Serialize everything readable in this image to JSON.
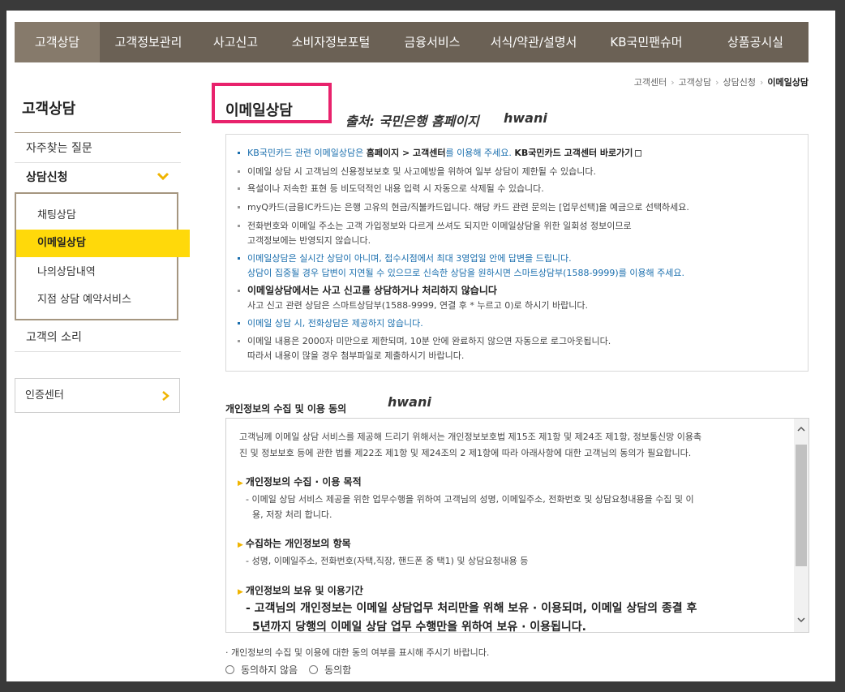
{
  "gnb": [
    "고객상담",
    "고객정보관리",
    "사고신고",
    "소비자정보포털",
    "금융서비스",
    "서식/약관/설명서",
    "KB국민팬슈머",
    "상품공시실"
  ],
  "lnb": {
    "title": "고객상담",
    "faq": "자주찾는 질문",
    "apply": "상담신청",
    "sub": [
      "채팅상담",
      "이메일상담",
      "나의상담내역",
      "지점 상담 예약서비스"
    ],
    "voice": "고객의 소리",
    "cert": "인증센터"
  },
  "breadcrumb": [
    "고객센터",
    "고객상담",
    "상담신청",
    "이메일상담"
  ],
  "page_title": "이메일상담",
  "source_note": "출처: 국민은행 홈페이지",
  "watermark": "hwani",
  "notice": {
    "l1a": "KB국민카드 관련 이메일상담은 ",
    "l1b": "홈페이지 > 고객센터",
    "l1c": "를 이용해 주세요. ",
    "l1d": "KB국민카드 고객센터 바로가기",
    "l2": "이메일 상담 시 고객님의 신용정보보호 및 사고예방을 위하여 일부 상담이 제한될 수 있습니다.",
    "l3": "욕설이나 저속한 표현 등 비도덕적인 내용 입력 시 자동으로 삭제될 수 있습니다.",
    "l4": "myQ카드(금융IC카드)는 은행 고유의 현금/직불카드입니다. 해당 카드 관련 문의는 [업무선택]을 예금으로 선택하세요.",
    "l5a": "전화번호와 이메일 주소는 고객 가입정보와 다르게 쓰셔도 되지만 이메일상담을 위한 일회성 정보이므로",
    "l5b": "고객정보에는 반영되지 않습니다.",
    "l6a": "이메일상담은 실시간 상담이 아니며, 접수시점에서 최대 3영업일 안에 답변을 드립니다.",
    "l6b": "상담이 집중될 경우 답변이 지연될 수 있으므로 신속한 상담을 원하시면 스마트상담부(1588-9999)를 이용해 주세요.",
    "l7a": "이메일상담에서는 사고 신고를 상담하거나 처리하지 않습니다",
    "l7b": "사고 신고 관련 상담은 스마트상담부(1588-9999, 연결 후 * 누르고 0)로 하시기 바랍니다.",
    "l8": "이메일 상담 시, 전화상담은 제공하지 않습니다.",
    "l9a": "이메일 내용은 2000자 미만으로 제한되며, 10분 안에 완료하지 않으면 자동으로 로그아웃됩니다.",
    "l9b": "따라서 내용이 많을 경우 첨부파일로 제출하시기 바랍니다."
  },
  "consent": {
    "title": "개인정보의 수집 및 이용 동의",
    "intro1": "고객님께 이메일 상담 서비스를 제공해 드리기 위해서는 개인정보보호법 제15조 제1항 및 제24조 제1항, 정보통신망 이용촉",
    "intro2": "진 및 정보보호 등에 관한 법률 제22조 제1항 및 제24조의 2 제1항에 따라 아래사항에 대한 고객님의 동의가 필요합니다.",
    "h1": "개인정보의 수집 · 이용 목적",
    "d1a": "- 이메일 상담 서비스 제공을 위한 업무수행을 위하여 고객님의 성명, 이메일주소, 전화번호 및 상담요청내용을 수집 및 이",
    "d1b": "용, 저장 처리 합니다.",
    "h2": "수집하는 개인정보의 항목",
    "d2": "- 성명, 이메일주소, 전화번호(자택,직장, 핸드폰 중 택1) 및 상담요청내용 등",
    "h3": "개인정보의 보유 및 이용기간",
    "d3a": "- 고객님의 개인정보는 이메일 상담업무 처리만을 위해 보유 · 이용되며, 이메일 상담의 종결 후",
    "d3b": "5년까지 당행의 이메일 상담 업무 수행만을 위하여 보유 · 이용됩니다."
  },
  "agree_note": "· 개인정보의 수집 및 이용에 대한 동의 여부를 표시해 주시기 바랍니다.",
  "radio": {
    "no": "동의하지 않음",
    "yes": "동의함"
  }
}
